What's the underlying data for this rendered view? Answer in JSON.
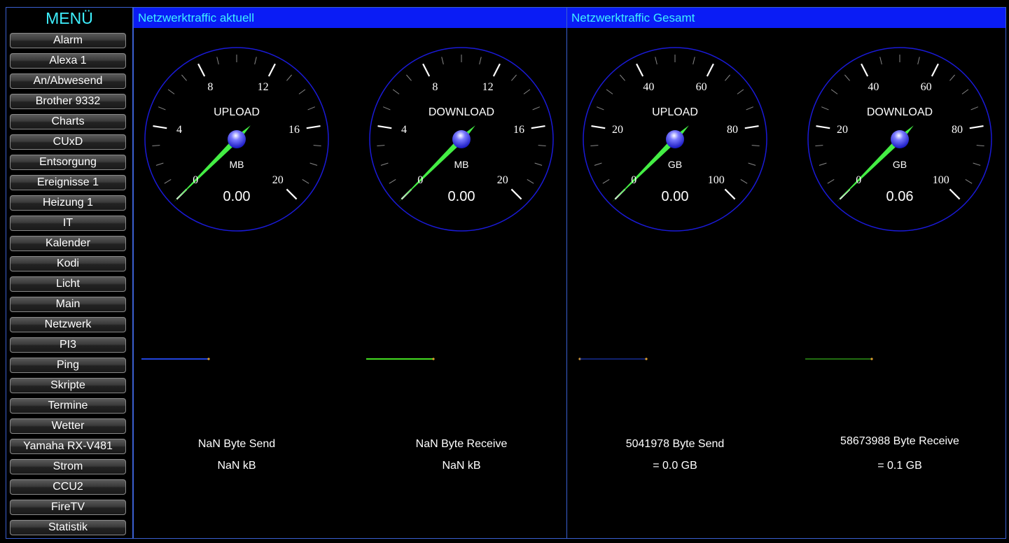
{
  "menu": {
    "title": "MENÜ",
    "items": [
      "Alarm",
      "Alexa 1",
      "An/Abwesend",
      "Brother 9332",
      "Charts",
      "CUxD",
      "Entsorgung",
      "Ereignisse 1",
      "Heizung 1",
      "IT",
      "Kalender",
      "Kodi",
      "Licht",
      "Main",
      "Netzwerk",
      "PI3",
      "Ping",
      "Skripte",
      "Termine",
      "Wetter",
      "Yamaha RX-V481",
      "Strom",
      "CCU2",
      "FireTV",
      "Statistik"
    ]
  },
  "panels": {
    "current": {
      "title": "Netzwerktraffic aktuell",
      "gauges": [
        {
          "label": "UPLOAD",
          "unit": "MB",
          "value": "0.00",
          "ticks": [
            "0",
            "4",
            "8",
            "12",
            "16",
            "20"
          ],
          "max": 20,
          "reading": 0
        },
        {
          "label": "DOWNLOAD",
          "unit": "MB",
          "value": "0.00",
          "ticks": [
            "0",
            "4",
            "8",
            "12",
            "16",
            "20"
          ],
          "max": 20,
          "reading": 0
        }
      ],
      "info": [
        {
          "line1": "NaN Byte Send",
          "line2": "NaN kB"
        },
        {
          "line1": "NaN Byte Receive",
          "line2": "NaN kB"
        }
      ]
    },
    "total": {
      "title": "Netzwerktraffic Gesamt",
      "gauges": [
        {
          "label": "UPLOAD",
          "unit": "GB",
          "value": "0.00",
          "ticks": [
            "0",
            "20",
            "40",
            "60",
            "80",
            "100"
          ],
          "max": 100,
          "reading": 0
        },
        {
          "label": "DOWNLOAD",
          "unit": "GB",
          "value": "0.06",
          "ticks": [
            "0",
            "20",
            "40",
            "60",
            "80",
            "100"
          ],
          "max": 100,
          "reading": 0.06
        }
      ],
      "info": [
        {
          "line1": "5041978 Byte Send",
          "line2": "= 0.0 GB"
        },
        {
          "line1": "58673988 Byte Receive",
          "line2": "= 0.1 GB"
        }
      ]
    }
  },
  "colors": {
    "needle": "#44ee44",
    "dial_ring": "#1a1ad8",
    "header_bg": "#0a1cf5",
    "header_text": "#3ef0ff",
    "upload_line": "#2244dd",
    "download_line": "#44dd22"
  }
}
